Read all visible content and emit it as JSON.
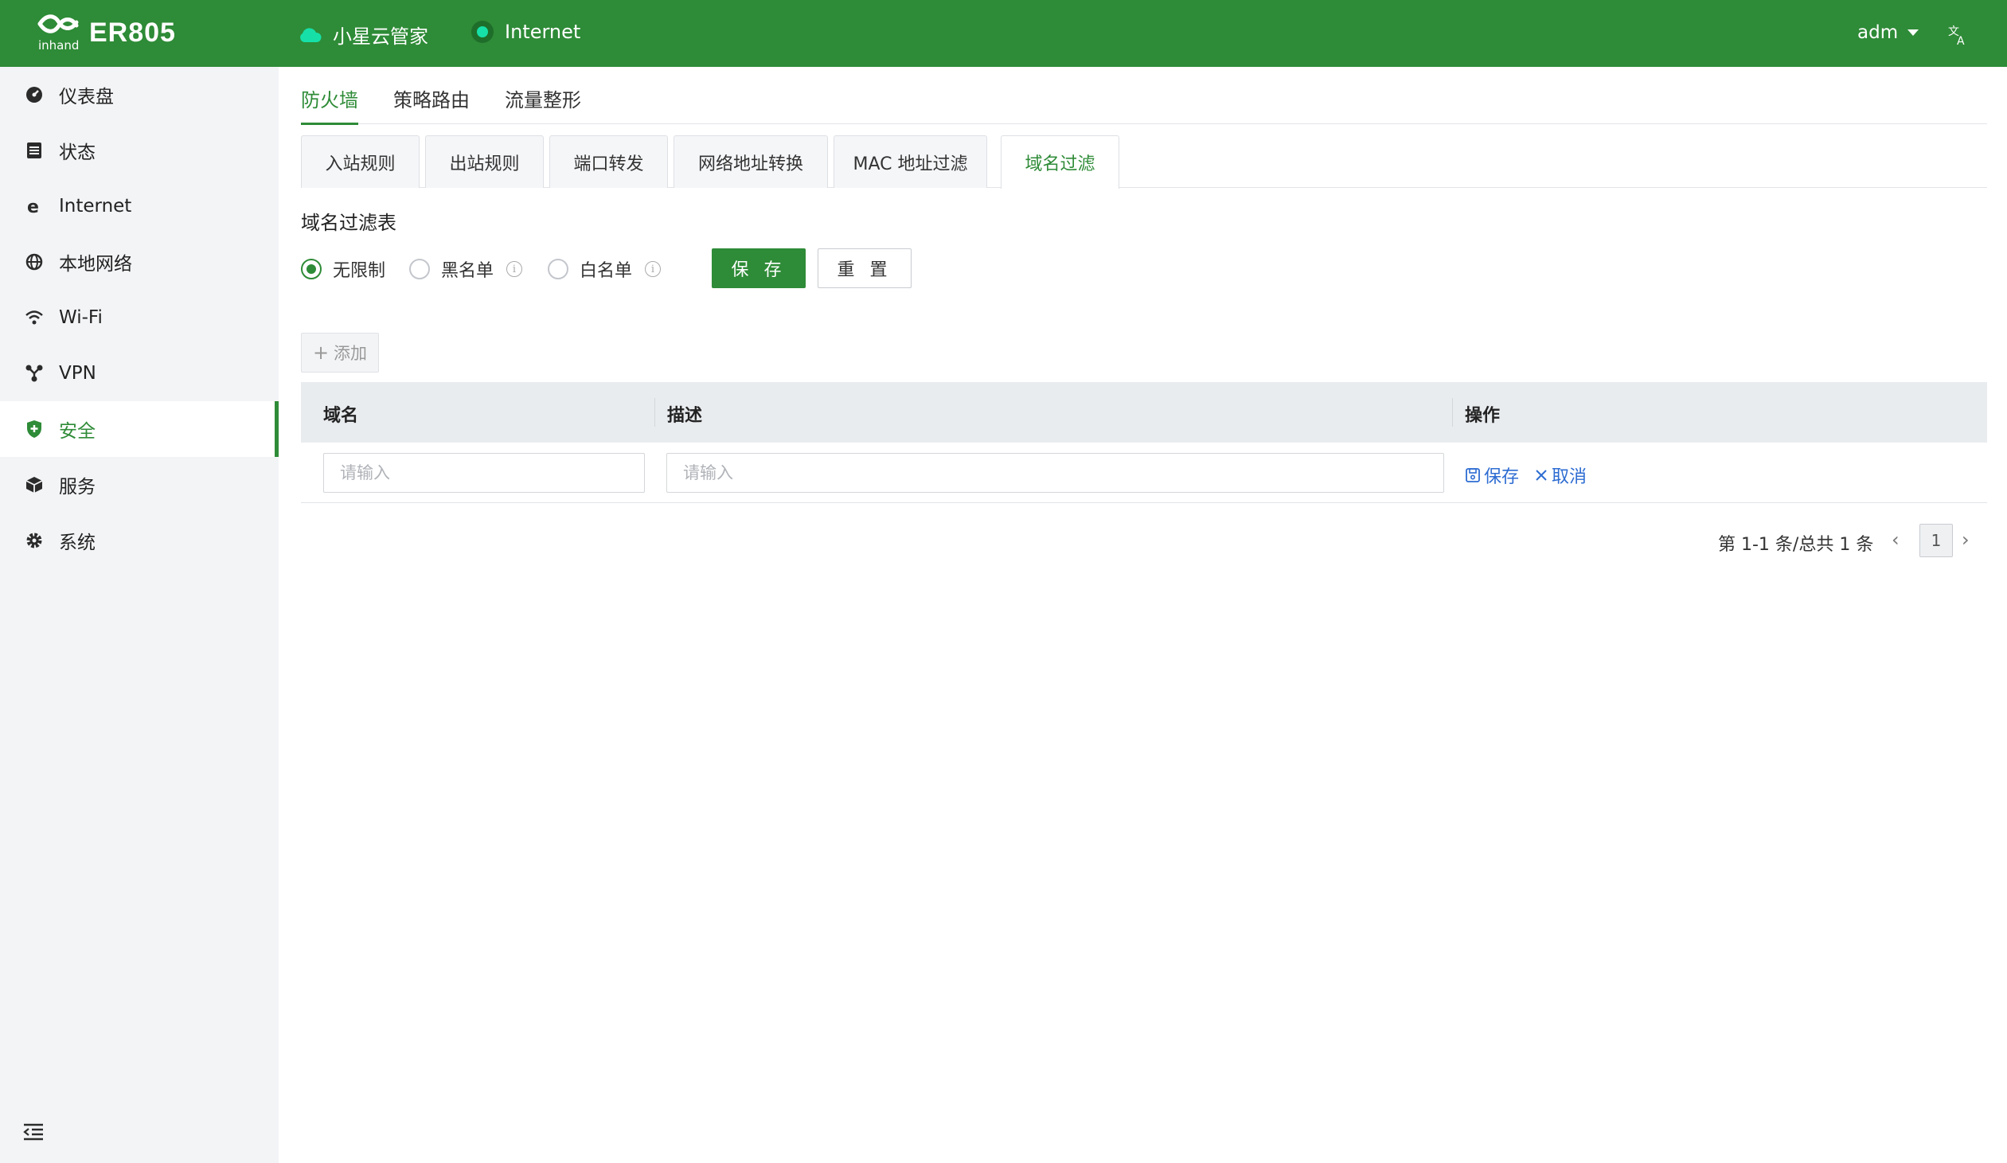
{
  "header": {
    "brand": "ER805",
    "logo_text": "inhand",
    "cloud_label": "小星云管家",
    "internet_label": "Internet",
    "user": "adm",
    "icons": {
      "cloud": "cloud-icon",
      "internet": "status-dot-icon",
      "language": "translate-icon"
    }
  },
  "sidebar": {
    "items": [
      {
        "label": "仪表盘",
        "icon": "dashboard-icon"
      },
      {
        "label": "状态",
        "icon": "status-icon"
      },
      {
        "label": "Internet",
        "icon": "internet-icon"
      },
      {
        "label": "本地网络",
        "icon": "globe-icon"
      },
      {
        "label": "Wi-Fi",
        "icon": "wifi-icon"
      },
      {
        "label": "VPN",
        "icon": "vpn-icon"
      },
      {
        "label": "安全",
        "icon": "shield-icon",
        "active": true
      },
      {
        "label": "服务",
        "icon": "box-icon"
      },
      {
        "label": "系统",
        "icon": "gear-icon"
      }
    ]
  },
  "top_tabs": [
    "防火墙",
    "策略路由",
    "流量整形"
  ],
  "sub_tabs": [
    "入站规则",
    "出站规则",
    "端口转发",
    "网络地址转换",
    "MAC 地址过滤",
    "域名过滤"
  ],
  "section": {
    "title": "域名过滤表",
    "options": [
      "无限制",
      "黑名单",
      "白名单"
    ],
    "selected": "无限制",
    "save_label": "保 存",
    "reset_label": "重 置"
  },
  "table": {
    "add_label": "添加",
    "columns": [
      "域名",
      "描述",
      "操作"
    ],
    "row": {
      "domain_placeholder": "请输入",
      "desc_placeholder": "请输入",
      "save_action": "保存",
      "cancel_action": "取消"
    }
  },
  "pagination": {
    "summary": "第 1-1 条/总共 1 条",
    "current_page": "1"
  },
  "colors": {
    "brand": "#2e8b37",
    "link": "#2d6cd2"
  }
}
